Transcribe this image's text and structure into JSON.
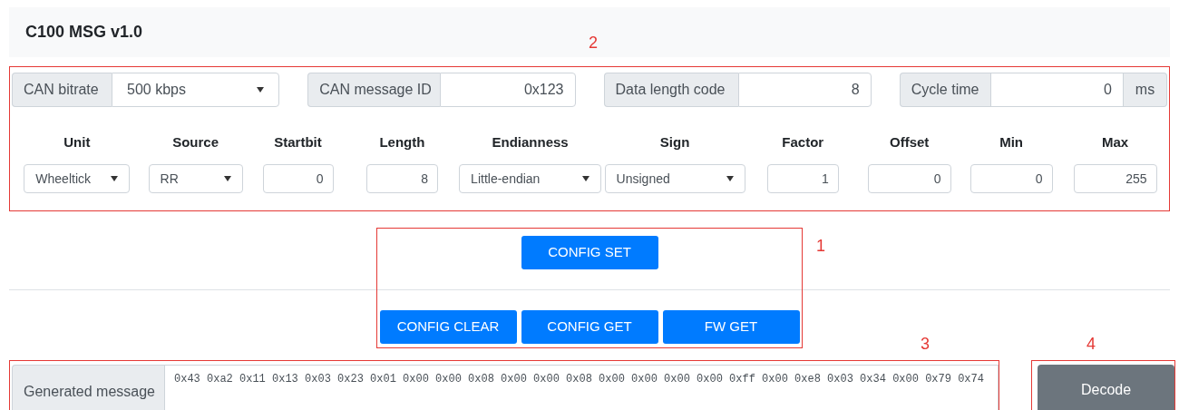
{
  "title": "C100 MSG v1.0",
  "signal_panel": {
    "annotation": "2",
    "settings": [
      {
        "label": "CAN bitrate",
        "kind": "select",
        "value": "500 kbps"
      },
      {
        "label": "CAN message ID",
        "kind": "input",
        "value": "0x123"
      },
      {
        "label": "Data length code",
        "kind": "input",
        "value": "8"
      },
      {
        "label": "Cycle time",
        "kind": "input",
        "value": "0",
        "unit": "ms"
      }
    ],
    "columns": [
      {
        "header": "Unit",
        "kind": "select",
        "value": "Wheeltick"
      },
      {
        "header": "Source",
        "kind": "select",
        "value": "RR"
      },
      {
        "header": "Startbit",
        "kind": "input",
        "value": "0"
      },
      {
        "header": "Length",
        "kind": "input",
        "value": "8"
      },
      {
        "header": "Endianness",
        "kind": "select",
        "value": "Little-endian"
      },
      {
        "header": "Sign",
        "kind": "select",
        "value": "Unsigned"
      },
      {
        "header": "Factor",
        "kind": "input",
        "value": "1"
      },
      {
        "header": "Offset",
        "kind": "input",
        "value": "0"
      },
      {
        "header": "Min",
        "kind": "input",
        "value": "0"
      },
      {
        "header": "Max",
        "kind": "input",
        "value": "255"
      }
    ]
  },
  "buttons_panel": {
    "annotation": "1",
    "primary": "CONFIG SET",
    "secondary": [
      "CONFIG CLEAR",
      "CONFIG GET",
      "FW GET"
    ]
  },
  "message_panel": {
    "annotation": "3",
    "label": "Generated message",
    "value": "0x43 0xa2 0x11 0x13 0x03 0x23 0x01 0x00 0x00 0x08 0x00 0x00 0x08 0x00 0x00 0x00 0x00 0xff 0x00 0xe8 0x03 0x34 0x00 0x79 0x74"
  },
  "decode_panel": {
    "annotation": "4",
    "button": "Decode"
  }
}
